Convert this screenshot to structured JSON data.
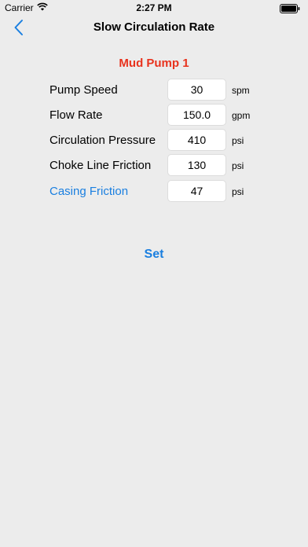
{
  "status_bar": {
    "carrier": "Carrier",
    "time": "2:27 PM",
    "wifi_icon": "wifi-icon",
    "battery_icon": "battery-icon"
  },
  "nav": {
    "title": "Slow Circulation Rate",
    "back_icon": "chevron-left-icon"
  },
  "section": {
    "title": "Mud Pump 1"
  },
  "rows": [
    {
      "label": "Pump Speed",
      "value": "30",
      "unit": "spm"
    },
    {
      "label": "Flow Rate",
      "value": "150.0",
      "unit": "gpm"
    },
    {
      "label": "Circulation Pressure",
      "value": "410",
      "unit": "psi"
    },
    {
      "label": "Choke Line Friction",
      "value": "130",
      "unit": "psi"
    },
    {
      "label": "Casing Friction",
      "value": "47",
      "unit": "psi"
    }
  ],
  "set_button": {
    "label": "Set"
  },
  "colors": {
    "accent": "#1a7fe0",
    "section_title": "#e8321d",
    "background": "#ececec"
  }
}
